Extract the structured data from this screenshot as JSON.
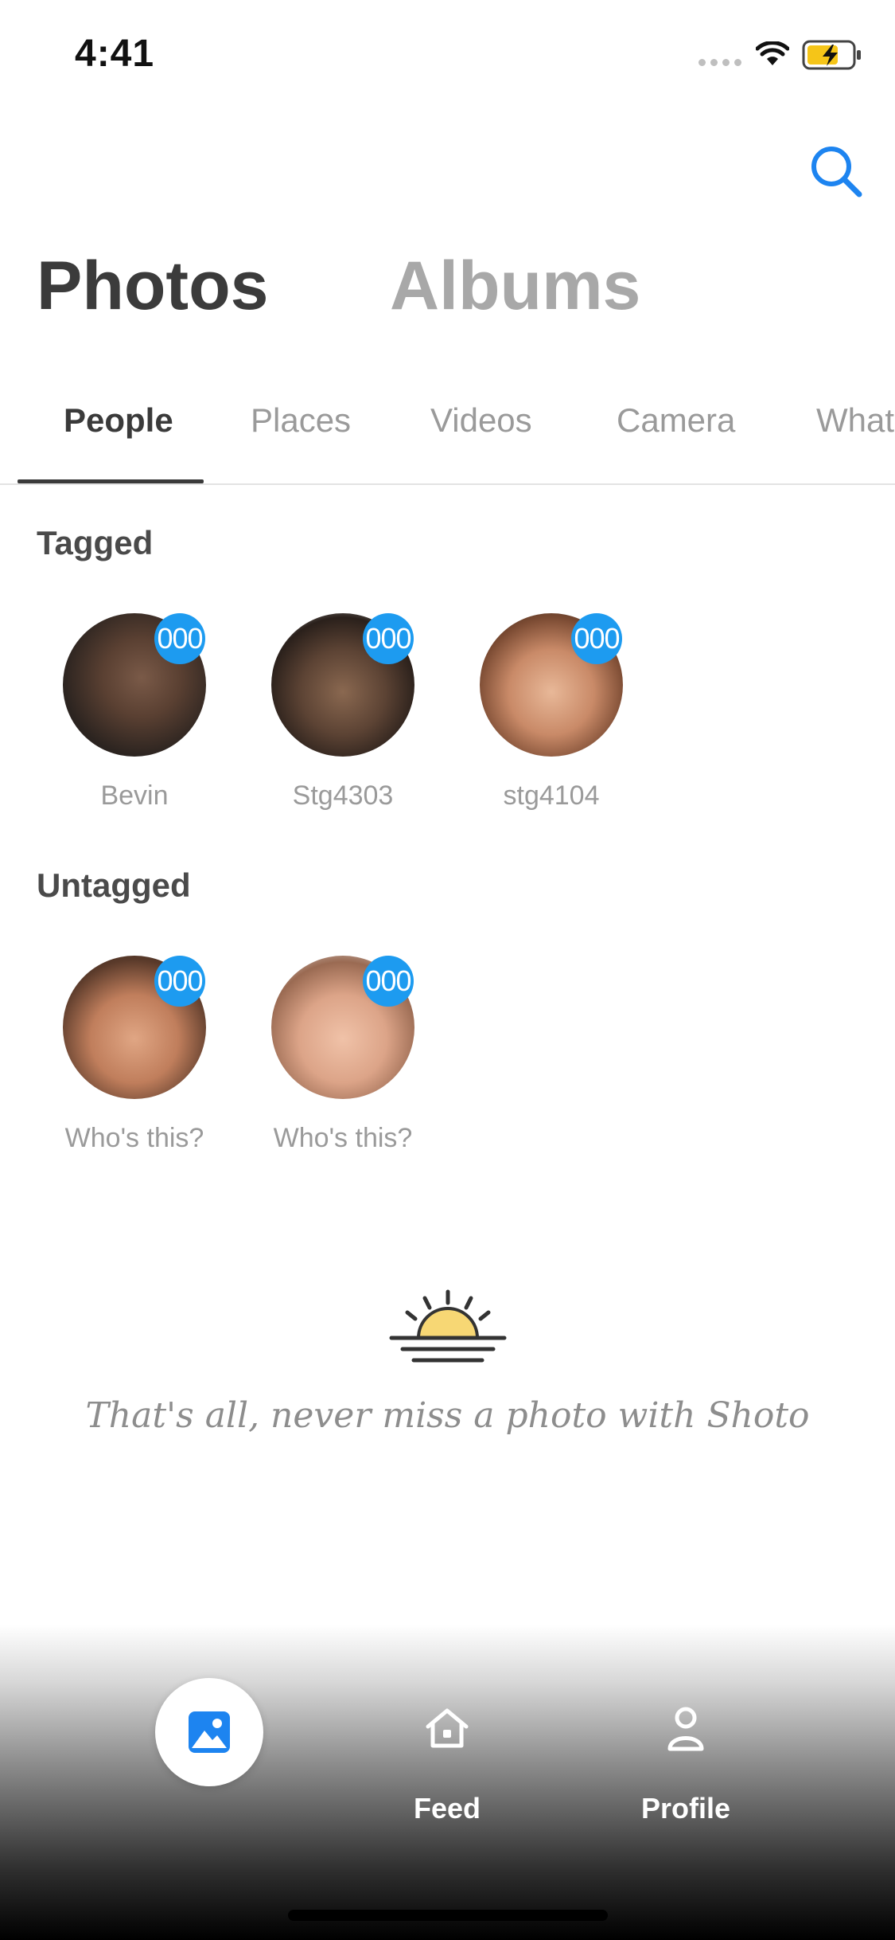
{
  "status_bar": {
    "time": "4:41"
  },
  "header": {
    "tabs": [
      {
        "label": "Photos",
        "active": true
      },
      {
        "label": "Albums",
        "active": false
      }
    ],
    "search_icon": "search-icon",
    "accent_color": "#1d9bf0"
  },
  "category_tabs": [
    {
      "label": "People",
      "active": true
    },
    {
      "label": "Places"
    },
    {
      "label": "Videos"
    },
    {
      "label": "Camera"
    },
    {
      "label": "What"
    }
  ],
  "tagged": {
    "title": "Tagged",
    "people": [
      {
        "name": "Bevin",
        "badge": "000"
      },
      {
        "name": "Stg4303",
        "badge": "000"
      },
      {
        "name": "stg4104",
        "badge": "000"
      }
    ]
  },
  "untagged": {
    "title": "Untagged",
    "people": [
      {
        "name": "Who's this?",
        "badge": "000"
      },
      {
        "name": "Who's this?",
        "badge": "000"
      }
    ]
  },
  "end_message": "That's all, never miss a photo with Shoto",
  "bottom_nav": {
    "items": [
      {
        "icon": "photo-icon",
        "label": ""
      },
      {
        "icon": "home-icon",
        "label": "Feed"
      },
      {
        "icon": "person-icon",
        "label": "Profile"
      }
    ]
  }
}
